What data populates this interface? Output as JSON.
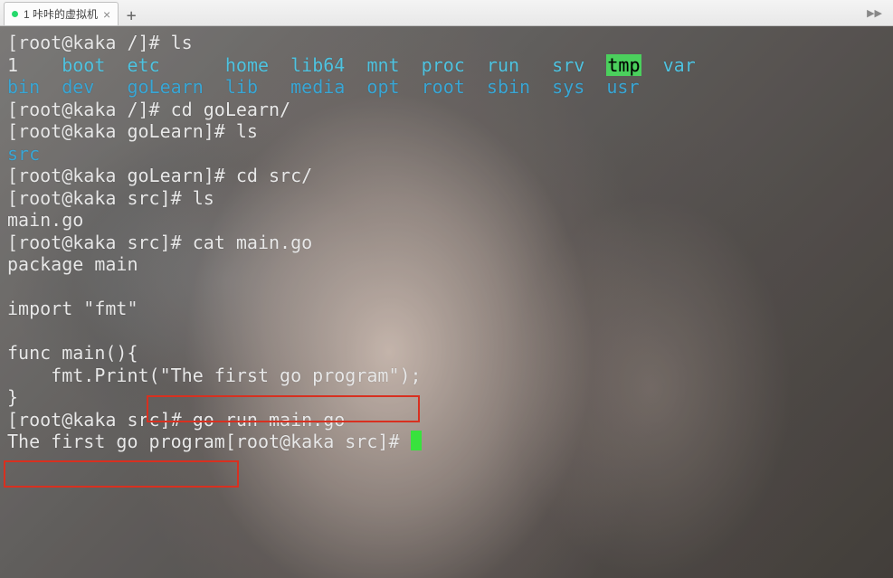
{
  "tab": {
    "title": "1 咔咔的虚拟机",
    "close": "×",
    "add": "+"
  },
  "term": {
    "p1": "[root@kaka /]# ",
    "cmd1": "ls",
    "row1": {
      "a": "1",
      "b": "boot",
      "c": "etc",
      "d": "home",
      "e": "lib64",
      "f": "mnt",
      "g": "proc",
      "h": "run",
      "i": "srv",
      "j": "tmp",
      "k": "var"
    },
    "row2": {
      "a": "bin",
      "b": "dev",
      "c": "goLearn",
      "d": "lib",
      "e": "media",
      "f": "opt",
      "g": "root",
      "h": "sbin",
      "i": "sys",
      "j": "usr"
    },
    "p2": "[root@kaka /]# ",
    "cmd2": "cd goLearn/",
    "p3": "[root@kaka goLearn]# ",
    "cmd3": "ls",
    "ls3": "src",
    "p4": "[root@kaka goLearn]# ",
    "cmd4": "cd src/",
    "p5": "[root@kaka src]# ",
    "cmd5": "ls",
    "ls5": "main.go",
    "p6": "[root@kaka src]# ",
    "cmd6": "cat main.go",
    "src_line1": "package main",
    "src_line2": "",
    "src_line3": "import \"fmt\"",
    "src_line4": "",
    "src_line5": "func main(){",
    "src_line6a": "    fmt.Print(\"",
    "src_line6b": "The first go program",
    "src_line6c": "\");",
    "src_line7": "}",
    "p7": "[root@kaka src]# ",
    "cmd7": "go run main.go",
    "out": "The first go program",
    "p8": "[root@kaka src]# "
  }
}
